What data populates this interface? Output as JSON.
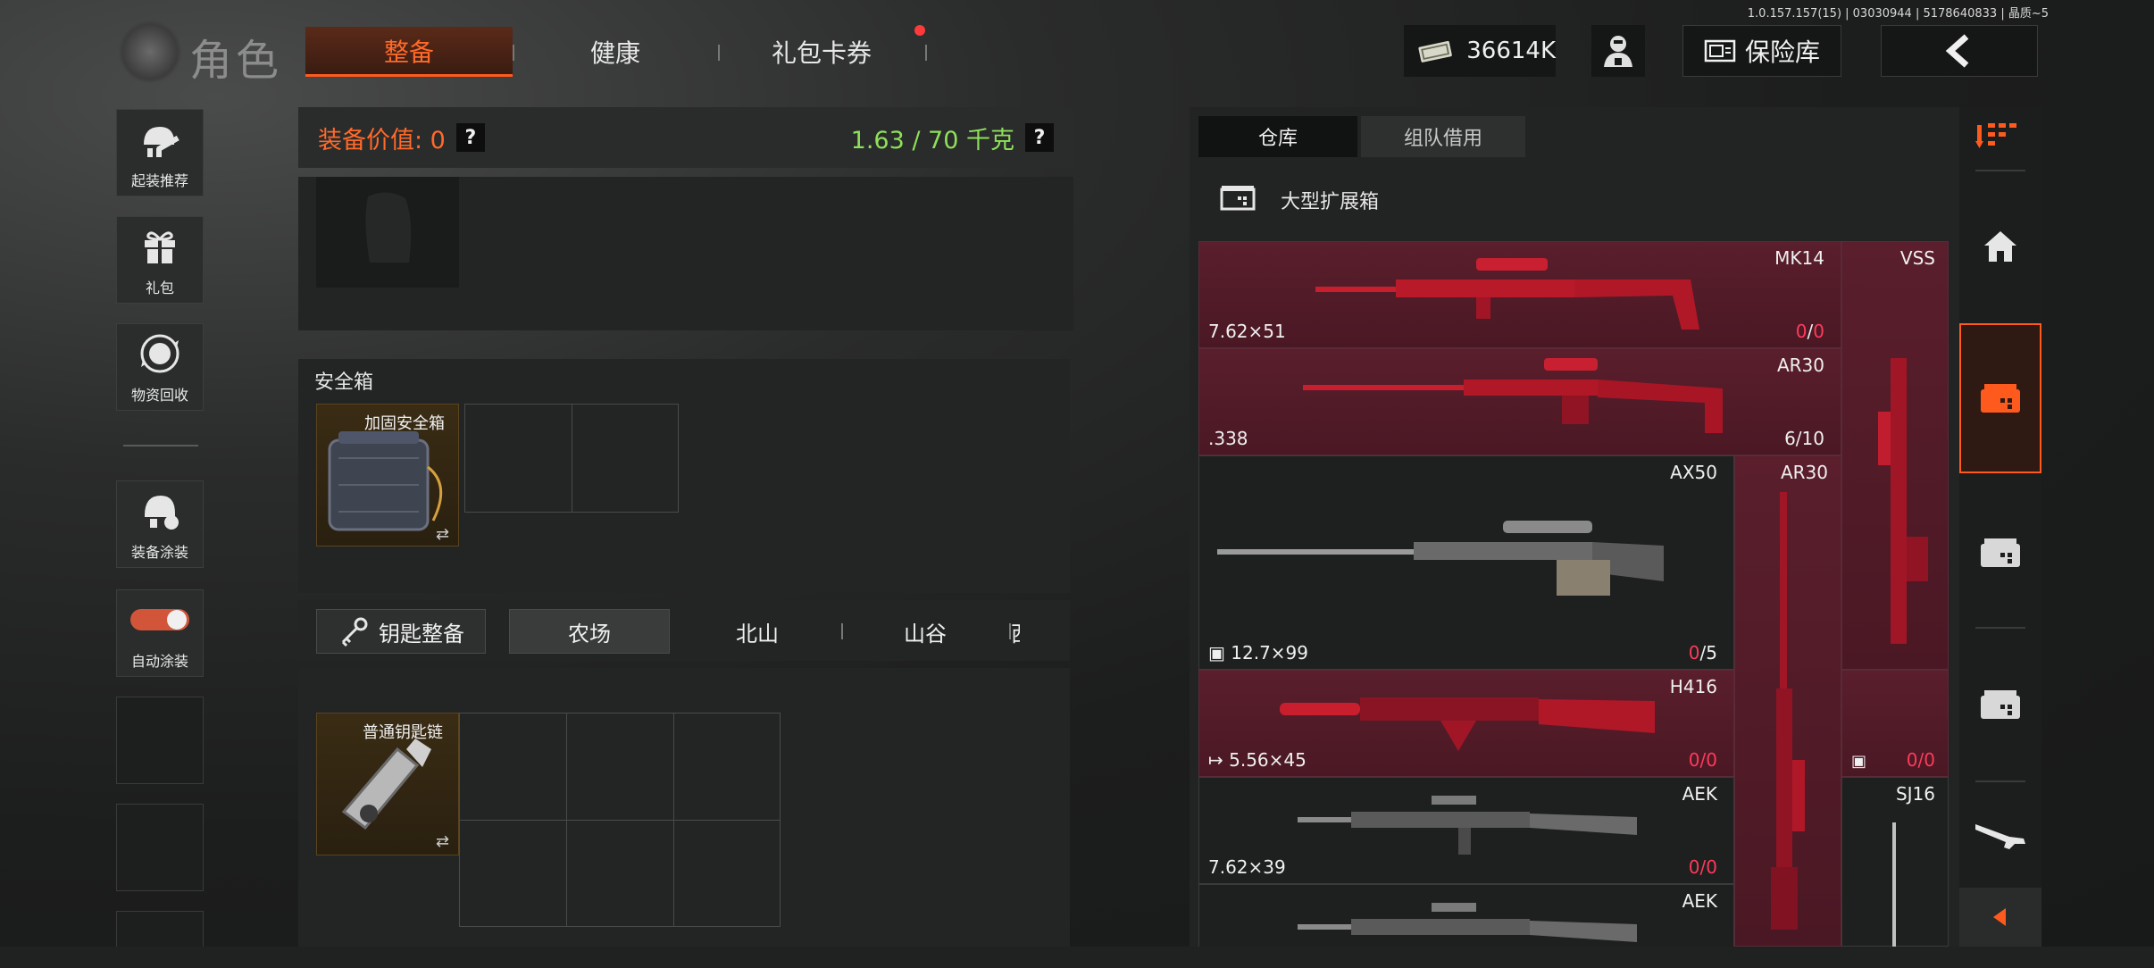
{
  "version": "1.0.157.157(15) | 03030944 | 5178640833 | 晶质~5",
  "title": "角色",
  "top_tabs": [
    {
      "label": "整备",
      "active": true
    },
    {
      "label": "健康",
      "active": false
    },
    {
      "label": "礼包卡券",
      "active": false
    }
  ],
  "currency": {
    "amount": "36614K",
    "icon": "cash-icon"
  },
  "vault_label": "保险库",
  "sidebar": {
    "items": [
      {
        "label": "起装推荐",
        "icon": "helmet-gun-icon"
      },
      {
        "label": "礼包",
        "icon": "gift-icon"
      },
      {
        "label": "物资回收",
        "icon": "recycle-icon"
      },
      {
        "label": "装备涂装",
        "icon": "paint-helmet-icon"
      },
      {
        "label": "自动涂装",
        "icon": "toggle-icon"
      }
    ]
  },
  "equipment": {
    "value_label": "装备价值: 0",
    "weight_label": "1.63 / 70 千克",
    "help": "?"
  },
  "safe_box": {
    "section_label": "安全箱",
    "item_label": "加固安全箱",
    "swap": "⇄"
  },
  "keys": {
    "button_label": "钥匙整备",
    "map_tabs": [
      {
        "label": "农场",
        "active": true
      },
      {
        "label": "北山",
        "active": false
      },
      {
        "label": "山谷",
        "active": false
      },
      {
        "label": "西",
        "active": false
      }
    ],
    "item_label": "普通钥匙链",
    "swap": "⇄"
  },
  "warehouse": {
    "tabs": [
      {
        "label": "仓库",
        "active": true
      },
      {
        "label": "组队借用",
        "active": false
      }
    ],
    "box_label": "大型扩展箱",
    "weapons": [
      {
        "name": "MK14",
        "ammo": "7.62×51",
        "count_cur": "0",
        "count_sep": "/",
        "count_max": "0"
      },
      {
        "name": "VSS",
        "ammo": "",
        "count_cur": "0",
        "count_sep": "/",
        "count_max": "0"
      },
      {
        "name": "AR30",
        "ammo": ".338",
        "count_cur": "6",
        "count_sep": "/",
        "count_max": "10"
      },
      {
        "name": "AX50",
        "ammo": "12.7×99",
        "count_cur": "0",
        "count_sep": "/",
        "count_max": "5"
      },
      {
        "name": "AR30",
        "ammo": "",
        "count_cur": "",
        "count_sep": "",
        "count_max": ""
      },
      {
        "name": "H416",
        "ammo": "5.56×45",
        "count_cur": "0",
        "count_sep": "/",
        "count_max": "0"
      },
      {
        "name": "AEK",
        "ammo": "7.62×39",
        "count_cur": "0",
        "count_sep": "/",
        "count_max": "0"
      },
      {
        "name": "SJ16",
        "ammo": "",
        "count_cur": "",
        "count_sep": "",
        "count_max": ""
      },
      {
        "name": "AEK",
        "ammo": "",
        "count_cur": "",
        "count_sep": "",
        "count_max": ""
      }
    ]
  },
  "colors": {
    "accent": "#ff5a1e",
    "weight_green": "#8ee05a",
    "count_red": "#ff3a5a",
    "weapon_bg": "#5a1e2c"
  }
}
